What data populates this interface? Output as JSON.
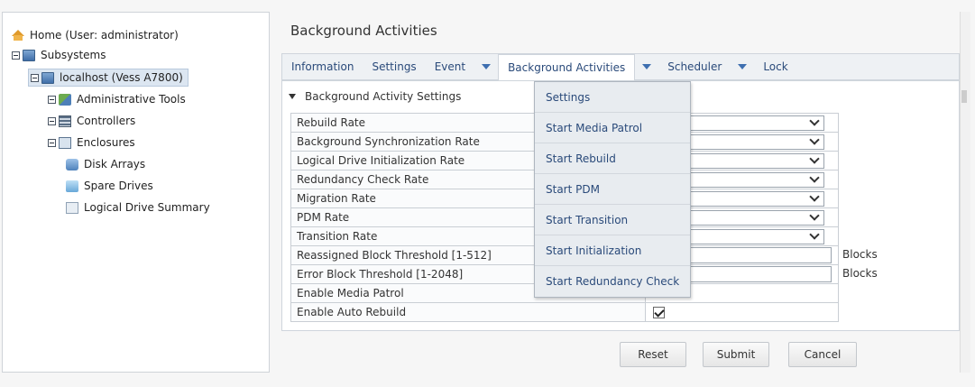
{
  "tree": {
    "home": "Home (User: administrator)",
    "subsystems": "Subsystems",
    "localhost": "localhost (Vess A7800)",
    "admin_tools": "Administrative Tools",
    "controllers": "Controllers",
    "enclosures": "Enclosures",
    "disk_arrays": "Disk Arrays",
    "spare_drives": "Spare Drives",
    "logical_drive_summary": "Logical Drive Summary"
  },
  "page": {
    "title": "Background Activities"
  },
  "tabs": {
    "information": "Information",
    "settings": "Settings",
    "event": "Event",
    "background_activities": "Background Activities",
    "scheduler": "Scheduler",
    "lock": "Lock"
  },
  "section": {
    "title": "Background Activity Settings"
  },
  "rows": [
    {
      "label": "Rebuild Rate",
      "value": ""
    },
    {
      "label": "Background Synchronization Rate",
      "value": ""
    },
    {
      "label": "Logical Drive Initialization Rate",
      "value": "m"
    },
    {
      "label": "Redundancy Check Rate",
      "value": ""
    },
    {
      "label": "Migration Rate",
      "value": ""
    },
    {
      "label": "PDM Rate",
      "value": ""
    },
    {
      "label": "Transition Rate",
      "value": "m"
    },
    {
      "label": "Reassigned Block Threshold [1-512]",
      "value": ""
    },
    {
      "label": "Error Block Threshold [1-2048]",
      "value": ""
    },
    {
      "label": "Enable Media Patrol",
      "value": ""
    },
    {
      "label": "Enable Auto Rebuild",
      "value": ""
    }
  ],
  "units": {
    "blocks": "Blocks"
  },
  "menu": {
    "settings": "Settings",
    "start_media_patrol": "Start Media Patrol",
    "start_rebuild": "Start Rebuild",
    "start_pdm": "Start PDM",
    "start_transition": "Start Transition",
    "start_initialization": "Start Initialization",
    "start_redundancy_check": "Start Redundancy Check"
  },
  "buttons": {
    "reset": "Reset",
    "submit": "Submit",
    "cancel": "Cancel"
  },
  "checkbox": {
    "enable_auto_rebuild_checked": true
  }
}
